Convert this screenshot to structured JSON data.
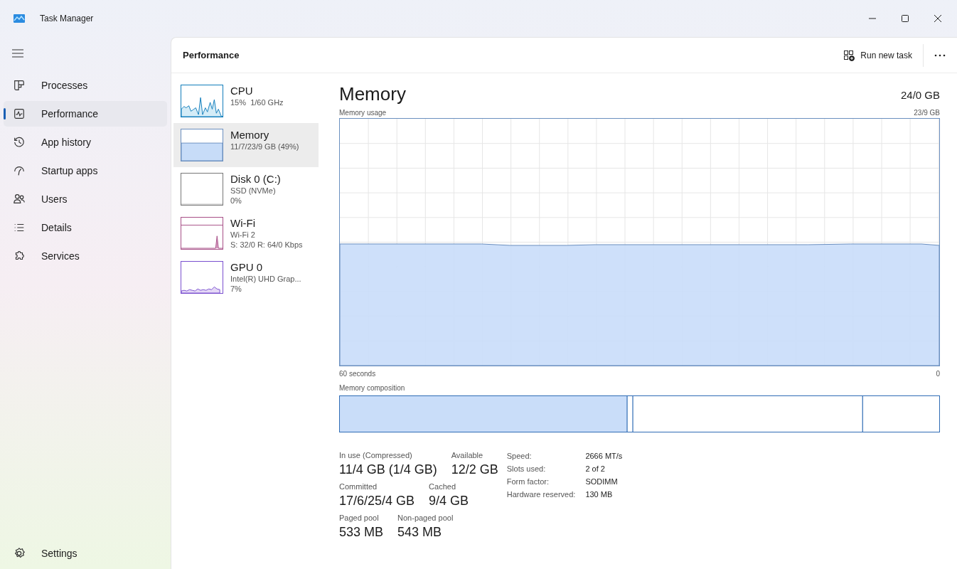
{
  "window": {
    "title": "Task Manager"
  },
  "sidebar": {
    "items": [
      {
        "label": "Processes",
        "kind": "processes",
        "selected": false
      },
      {
        "label": "Performance",
        "kind": "performance",
        "selected": true
      },
      {
        "label": "App history",
        "kind": "history",
        "selected": false
      },
      {
        "label": "Startup apps",
        "kind": "startup",
        "selected": false
      },
      {
        "label": "Users",
        "kind": "users",
        "selected": false
      },
      {
        "label": "Details",
        "kind": "details",
        "selected": false
      },
      {
        "label": "Services",
        "kind": "services",
        "selected": false
      }
    ],
    "footer": {
      "label": "Settings"
    }
  },
  "header": {
    "title": "Performance",
    "run_task": "Run new task"
  },
  "devices": [
    {
      "kind": "cpu",
      "name": "CPU",
      "lines": [
        "15%  1/60 GHz"
      ],
      "selected": false
    },
    {
      "kind": "memory",
      "name": "Memory",
      "lines": [
        "11/7/23/9 GB (49%)"
      ],
      "selected": true
    },
    {
      "kind": "disk",
      "name": "Disk 0 (C:)",
      "lines": [
        "SSD (NVMe)",
        "0%"
      ],
      "selected": false
    },
    {
      "kind": "wifi",
      "name": "Wi-Fi",
      "lines": [
        "Wi-Fi 2",
        "S: 32/0 R: 64/0 Kbps"
      ],
      "selected": false
    },
    {
      "kind": "gpu",
      "name": "GPU 0",
      "lines": [
        "Intel(R) UHD Grap...",
        "7%"
      ],
      "selected": false
    }
  ],
  "detail": {
    "title": "Memory",
    "total": "24/0 GB",
    "usage_label": "Memory usage",
    "usage_max": "23/9 GB",
    "x_start": "60 seconds",
    "x_end": "0",
    "composition_label": "Memory composition",
    "stats": [
      [
        {
          "label": "In use (Compressed)",
          "value": "11/4 GB (1/4 GB)"
        },
        {
          "label": "Available",
          "value": "12/2 GB"
        }
      ],
      [
        {
          "label": "Committed",
          "value": "17/6/25/4 GB"
        },
        {
          "label": "Cached",
          "value": "9/4 GB"
        }
      ],
      [
        {
          "label": "Paged pool",
          "value": "533 MB"
        },
        {
          "label": "Non-paged pool",
          "value": "543 MB"
        }
      ]
    ],
    "specs": [
      {
        "label": "Speed:",
        "value": "2666 MT/s"
      },
      {
        "label": "Slots used:",
        "value": "2 of 2"
      },
      {
        "label": "Form factor:",
        "value": "SODIMM"
      },
      {
        "label": "Hardware reserved:",
        "value": "130 MB"
      }
    ]
  }
}
